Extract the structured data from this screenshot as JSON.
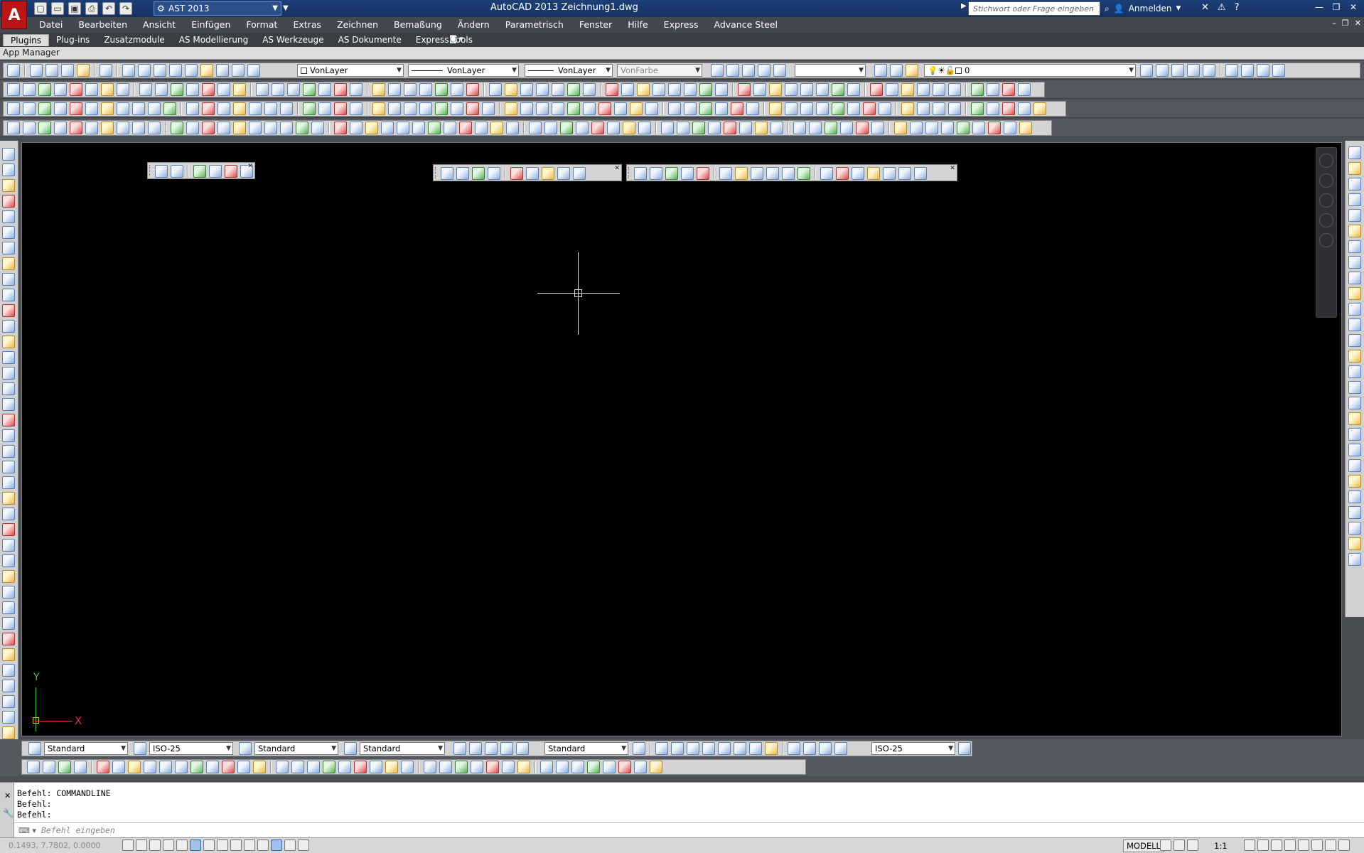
{
  "titlebar": {
    "app_logo": "A",
    "workspace": "AST 2013",
    "title": "AutoCAD 2013   Zeichnung1.dwg",
    "search_placeholder": "Stichwort oder Frage eingeben",
    "signin_label": "Anmelden"
  },
  "menu": {
    "items": [
      "Datei",
      "Bearbeiten",
      "Ansicht",
      "Einfügen",
      "Format",
      "Extras",
      "Zeichnen",
      "Bemaßung",
      "Ändern",
      "Parametrisch",
      "Fenster",
      "Hilfe",
      "Express",
      "Advance Steel"
    ]
  },
  "ribbon": {
    "tabs": [
      "Plugins",
      "Plug-ins",
      "Zusatzmodule",
      "AS Modellierung",
      "AS Werkzeuge",
      "AS Dokumente",
      "Express Tools"
    ],
    "active_tab": "Plugins",
    "panel_label": "App Manager"
  },
  "properties": {
    "color": "VonLayer",
    "linetype": "VonLayer",
    "lineweight": "VonLayer",
    "plotstyle": "VonFarbe",
    "layer": "0"
  },
  "styles": {
    "text_style": "Standard",
    "dim_style": "ISO-25",
    "table_style": "Standard",
    "mleader_style": "Standard",
    "mleader_style2": "Standard",
    "dim_style2": "ISO-25"
  },
  "ucs": {
    "x_label": "X",
    "y_label": "Y"
  },
  "command": {
    "history": [
      "Befehl: COMMANDLINE",
      "Befehl:",
      "Befehl:"
    ],
    "placeholder": "Befehl eingeben"
  },
  "status": {
    "coords": "0.1493, 7.7802, 0.0000",
    "model": "MODELL",
    "scale": "1:1"
  },
  "colors": {
    "title_bar": "#1d3f79",
    "canvas": "#000000",
    "ucs_x": "#dd3333",
    "ucs_y": "#3ec83e"
  }
}
